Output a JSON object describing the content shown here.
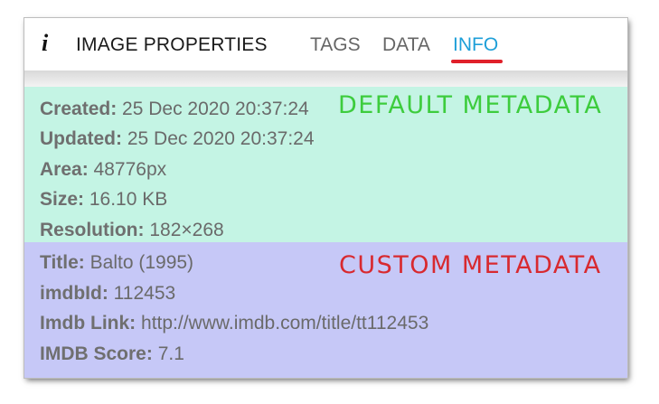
{
  "header": {
    "icon": "info-icon",
    "icon_glyph": "i",
    "title": "IMAGE PROPERTIES",
    "tabs": [
      {
        "label": "TAGS",
        "active": false
      },
      {
        "label": "DATA",
        "active": false
      },
      {
        "label": "INFO",
        "active": true
      }
    ]
  },
  "default_metadata": [
    {
      "key": "Created:",
      "value": "25 Dec 2020 20:37:24"
    },
    {
      "key": "Updated:",
      "value": "25 Dec 2020 20:37:24"
    },
    {
      "key": "Area:",
      "value": "48776px"
    },
    {
      "key": "Size:",
      "value": "16.10 KB"
    },
    {
      "key": "Resolution:",
      "value": "182×268"
    }
  ],
  "custom_metadata": [
    {
      "key": "Title:",
      "value": "Balto (1995)"
    },
    {
      "key": "imdbId:",
      "value": "112453"
    },
    {
      "key": "Imdb Link:",
      "value": "http://www.imdb.com/title/tt112453"
    },
    {
      "key": "IMDB Score:",
      "value": "7.1"
    }
  ],
  "annotations": {
    "default_label": "DEFAULT METADATA",
    "custom_label": "CUSTOM METADATA"
  },
  "colors": {
    "active_tab": "#1e9fd8",
    "tab_underline": "#e0202a",
    "default_bg": "#c4f4e4",
    "custom_bg": "#c6c8f7",
    "default_label": "#3dcc3d",
    "custom_label": "#d8292f"
  }
}
